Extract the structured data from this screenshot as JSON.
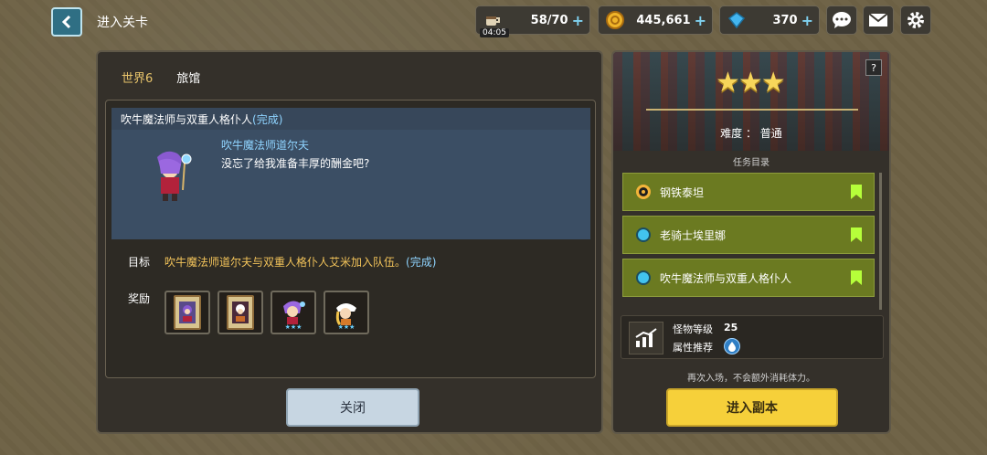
{
  "topbar": {
    "title": "进入关卡",
    "stamina": "58/70",
    "stamina_timer": "04:05",
    "gold": "445,661",
    "gems": "370",
    "plus": "+"
  },
  "left_panel": {
    "tab_world": "世界6",
    "tab_inn": "旅馆",
    "quest_title": "吹牛魔法师与双重人格仆人",
    "quest_status": "(完成)",
    "npc_name": "吹牛魔法师道尔夫",
    "npc_line": "没忘了给我准备丰厚的酬金吧?",
    "goal_label": "目标",
    "goal_text": "吹牛魔法师道尔夫与双重人格仆人艾米加入队伍。",
    "goal_status": "(完成)",
    "reward_label": "奖励",
    "close_label": "关闭"
  },
  "right_panel": {
    "help": "?",
    "stars": "★★★",
    "difficulty": "难度 ： 普通",
    "task_dir_title": "任务目录",
    "tasks": [
      {
        "label": "钢铁泰坦"
      },
      {
        "label": "老骑士埃里娜"
      },
      {
        "label": "吹牛魔法师与双重人格仆人"
      }
    ],
    "monster_level_label": "怪物等级",
    "monster_level_value": "25",
    "attribute_label": "属性推荐",
    "note": "再次入场，不会额外消耗体力。",
    "enter_label": "进入副本"
  },
  "colors": {
    "accent_yellow": "#f6d03a",
    "task_green": "#6b7a21",
    "complete_blue": "#8fd4ff",
    "goal_orange": "#f2c35a"
  }
}
